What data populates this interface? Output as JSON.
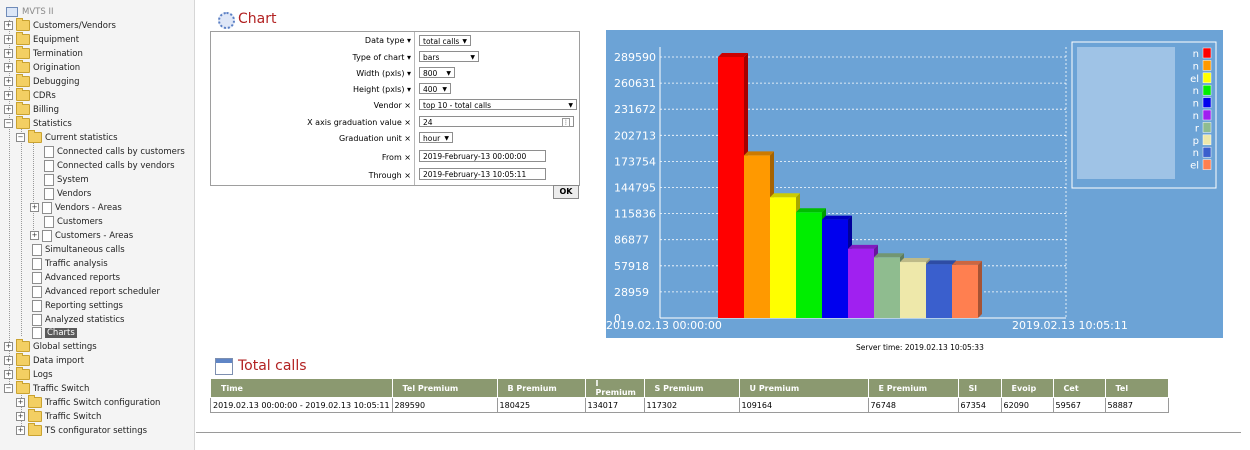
{
  "sidebar": {
    "app_title": "MVTS II",
    "items": [
      {
        "label": "Customers/Vendors"
      },
      {
        "label": "Equipment"
      },
      {
        "label": "Termination"
      },
      {
        "label": "Origination"
      },
      {
        "label": "Debugging"
      },
      {
        "label": "CDRs"
      },
      {
        "label": "Billing"
      },
      {
        "label": "Statistics"
      },
      {
        "label": "Current statistics"
      },
      {
        "label": "Connected calls by customers"
      },
      {
        "label": "Connected calls by vendors"
      },
      {
        "label": "System"
      },
      {
        "label": "Vendors"
      },
      {
        "label": "Vendors - Areas"
      },
      {
        "label": "Customers"
      },
      {
        "label": "Customers - Areas"
      },
      {
        "label": "Simultaneous calls"
      },
      {
        "label": "Traffic analysis"
      },
      {
        "label": "Advanced reports"
      },
      {
        "label": "Advanced report scheduler"
      },
      {
        "label": "Reporting settings"
      },
      {
        "label": "Analyzed statistics"
      },
      {
        "label": "Charts"
      },
      {
        "label": "Global settings"
      },
      {
        "label": "Data import"
      },
      {
        "label": "Logs"
      },
      {
        "label": "Traffic Switch"
      },
      {
        "label": "Traffic Switch configuration"
      },
      {
        "label": "Traffic Switch"
      },
      {
        "label": "TS configurator settings"
      }
    ]
  },
  "chart_section": {
    "title": "Chart"
  },
  "form": {
    "fields": [
      {
        "label": "Data type",
        "value": "total calls"
      },
      {
        "label": "Type of chart",
        "value": "bars"
      },
      {
        "label": "Width (pxls)",
        "value": "800"
      },
      {
        "label": "Height (pxls)",
        "value": "400"
      },
      {
        "label": "Vendor",
        "value": "top 10 - total calls"
      },
      {
        "label": "X axis graduation value",
        "value": "24"
      },
      {
        "label": "Graduation unit",
        "value": "hour"
      },
      {
        "label": "From",
        "value": "2019-February-13 00:00:00"
      },
      {
        "label": "Through",
        "value": "2019-February-13 10:05:11"
      }
    ],
    "ok_label": "OK"
  },
  "chart_data": {
    "type": "bar",
    "values": [
      289590,
      180425,
      134017,
      117302,
      109164,
      76748,
      67354,
      62090,
      59567,
      58887
    ],
    "colors": [
      "#ff0000",
      "#ff9900",
      "#ffff00",
      "#00ee00",
      "#0000ee",
      "#a020f0",
      "#8fbc8f",
      "#eee8aa",
      "#3a5fcd",
      "#ff7f50"
    ],
    "y_ticks": [
      "0",
      "28959",
      "57918",
      "86877",
      "115836",
      "144795",
      "173754",
      "202713",
      "231672",
      "260631",
      "289590"
    ],
    "ylim": [
      0,
      289590
    ],
    "x_labels": [
      "2019.02.13 00:00:00",
      "2019.02.13 10:05:11"
    ],
    "legend_tail": [
      "n",
      "n",
      "el",
      "n",
      "n",
      "n",
      "r",
      "p",
      "n",
      "el"
    ],
    "background": "#6ca3d6",
    "grid": true,
    "legend_position": "top-right"
  },
  "server_time": "Server time: 2019.02.13 10:05:33",
  "totals": {
    "title": "Total calls",
    "headers": [
      "Time",
      "Tel Premium",
      "B Premium",
      "I Premium",
      "S Premium",
      "U Premium",
      "E Premium",
      "Sl",
      "Evoip",
      "Cet",
      "Tel"
    ],
    "row": [
      "2019.02.13 00:00:00 - 2019.02.13 10:05:11",
      "289590",
      "180425",
      "134017",
      "117302",
      "109164",
      "76748",
      "67354",
      "62090",
      "59567",
      "58887"
    ]
  },
  "colors": {
    "title_red": "#b22222",
    "table_header": "#8b9970"
  }
}
